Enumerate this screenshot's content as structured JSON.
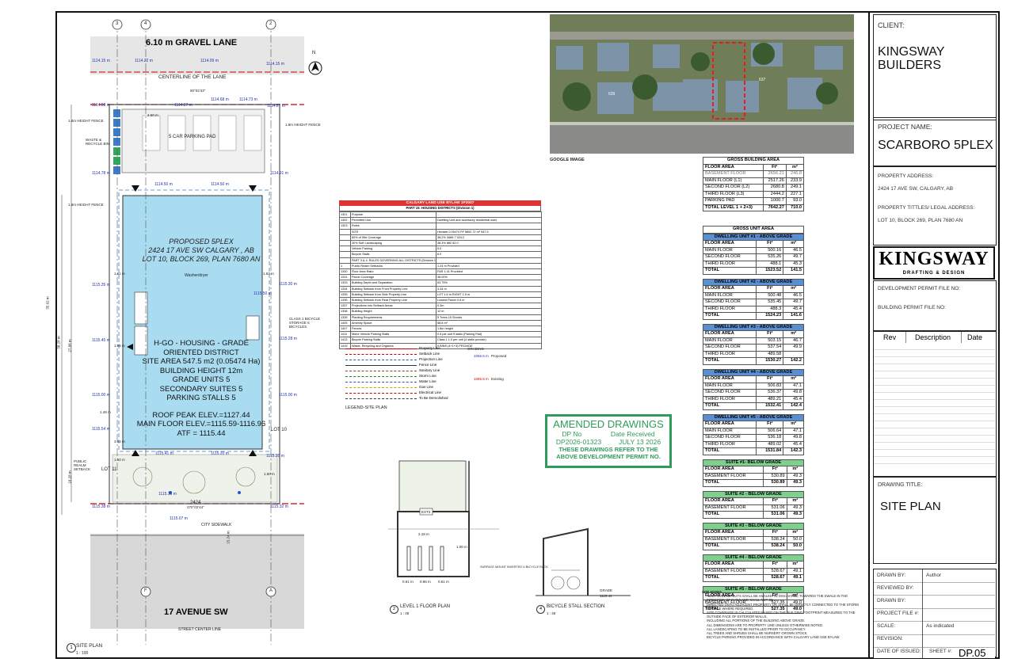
{
  "title_block": {
    "client_label": "CLIENT:",
    "client": "KINGSWAY BUILDERS",
    "project_name_label": "PROJECT NAME:",
    "project_name": "SCARBORO 5PLEX",
    "property_address_label": "PROPERTY ADDRESS:",
    "property_address": "2424 17 AVE SW, CALGARY, AB",
    "property_titles_label": "PROPERTY TITTLES/ LEGAL ADDRESS:",
    "property_titles": "LOT 10, BLOCK 269, PLAN 7680 AN",
    "logo_main": "KINGSWAY",
    "logo_sub": "DRAFTING & DESIGN",
    "dp_file_label": "DEVELOPMENT PERMIT FILE NO:",
    "bp_file_label": "BUILDING PERMIT  FILE NO:",
    "rev_headers": [
      "Rev",
      "Description",
      "Date"
    ],
    "drawing_title_label": "DRAWING TITLE:",
    "drawing_title": "SITE PLAN",
    "drawn_by_label": "DRAWN BY:",
    "drawn_by": "Author",
    "reviewed_by_label": "REVIEWED BY:",
    "drawn_by2_label": "DRAWN BY:",
    "project_file_label": "PROJECT FILE #:",
    "scale_label": "SCALE:",
    "scale": "As indicated",
    "revision_label": "REVISION:",
    "date_of_issue_label": "DATE OF ISSUED:",
    "sheet_label": "SHEET #:",
    "sheet": "DP.05"
  },
  "site_plan": {
    "lane": "6.10 m GRAVEL LANE",
    "lane_centerline": "CENTERLINE OF THE LANE",
    "avenue": "17 AVENUE SW",
    "street_centerline": "STREET CENTER LINE",
    "city_sidewalk": "CITY SIDEWALK",
    "public_realm": "PUBLIC REALM SETBACK",
    "parking_pad": "5 CAR PARKING PAD",
    "waste_bin": "WASTE & RECYCLE BIN",
    "height_fence_1": "1.8m HEIGHT FENCE",
    "height_fence_2": "1.8m HEIGHT FENCE",
    "height_fence_3": "1.8m HEIGHT FENCE",
    "bicycle_storage": "CLASS 1 BICYCLE STORAGE 6 BICYCLES",
    "north": "N",
    "proposed": "PROPOSED 5PLEX",
    "address": "2424 17 AVE SW CALGARY , AB",
    "legal": "LOT 10, BLOCK 269, PLAN 7680 AN",
    "zoning_1": "H-GO - HOUSING - GRADE",
    "zoning_2": "ORIENTED DISTRICT",
    "site_area": "SITE AREA 547.5 m2 (0.05474 Ha)",
    "building_height": "BUILDING HEIGHT 12m",
    "grade_units": "GRADE UNITS 5",
    "secondary_suites": "SECONDARY SUITES 5",
    "parking_stalls": "PARKING STALLS 5",
    "roof_peak": "ROOF PEAK ELEV.=1127.44",
    "main_floor": "MAIN FLOOR ELEV.=1115.59-1116.96",
    "atf": "ATF = 1115.44",
    "washer": "Washer/dryer",
    "number": "2424",
    "label_number": "1",
    "label_title": "SITE PLAN",
    "label_scale": "1 : 100",
    "grid_3": "3",
    "grid_4": "4",
    "grid_2": "2",
    "grid_f": "F",
    "grid_a": "A",
    "dims": {
      "d1": "1114.15 m",
      "d2": "1114.22 m",
      "d3": "1114.09 m",
      "d4": "1114.15 m",
      "d5": "1114.96 m",
      "d6": "1114.87 m",
      "d7": "1114.68 m",
      "d8": "1114.73 m",
      "d9": "1114.87 m",
      "d10": "1114.78 m",
      "d11": "1114.91 m",
      "d12": "1114.50 m",
      "d13": "1114.50 m",
      "d14": "1115.35 m",
      "d15": "1115.30 m",
      "d16": "1115.50 m",
      "d17": "1115.28 m",
      "d18": "1115.45 m",
      "d19": "1115.00 m",
      "d20": "1115.54 m",
      "d21": "1115.00 m",
      "d22": "1115.41 m",
      "d23": "1115.20 m",
      "d24": "1115.28 m",
      "d25": "1115.16 m",
      "d26": "1115.38 m",
      "d27": "1115.32 m",
      "d28": "1115.07 m",
      "bearing": "90°02'43\"",
      "bearing2": "270°02'44\"",
      "v1": "38.28 m",
      "v2": "27.88 m",
      "v3": "35.92 m",
      "v4": "35.94 m",
      "v5": "18.28 m",
      "w1": "2.50 m",
      "w2": "1.50 m",
      "w3": "1.61 m",
      "w4": "1.63 m",
      "w5": "1.65 m",
      "w6": "1.49 m",
      "w7": "3.64 m",
      "w8": "1.50 m",
      "w9": "15.24 m"
    },
    "lot_left": "LOT 11",
    "lot_right": "LOT 10"
  },
  "google": {
    "label": "GOOGLE IMAGE",
    "house_a": "639",
    "house_b": "637"
  },
  "bylaw": {
    "title": "CALGARY LAND USE BYLAW 1P2007",
    "part": "PART 15: HOUSING DISTRICTS (Division 1)",
    "rows": [
      [
        "1301",
        "Purpose",
        "..."
      ],
      [
        "1302",
        "Permitted Use",
        "Dwelling Unit and accessory residential uses"
      ],
      [
        "1303",
        "Rules",
        ""
      ],
      [
        "",
        "SITE",
        "Hectare  0.05474   Ft²  5892.72   m²  547.5"
      ],
      [
        "",
        "60% of Site Coverage",
        "38.2%   3489.7   324.2"
      ],
      [
        "",
        "30% Soft Landscaping",
        "38.3%   882   82.0"
      ],
      [
        "",
        "Vehicle Parking",
        "5.0"
      ],
      [
        "",
        "Bicycle Stalls",
        "6.0"
      ],
      [
        "",
        "PART 3 & 4: RULES GOVERNING ALL DISTRICTS (Division 1)",
        ""
      ],
      [
        "1",
        "Public Realm Setbacks",
        "1.24 m Provided"
      ],
      [
        "1330",
        "Floor Area Ratio",
        "FAR 1.41 Provided"
      ],
      [
        "1331",
        "Parcel Coverage",
        "38.00%"
      ],
      [
        "1333",
        "Building Depth and Separation",
        "63.75%"
      ],
      [
        "1334",
        "Building Setback from Front Property Line",
        "3.34 m"
      ],
      [
        "1335",
        "Building Setback from Side Property Line",
        "LOT 1.6 m   RIGHT 1.5 m"
      ],
      [
        "1336",
        "Building Setback from Rear Property Line",
        "Lowest Parcel 0.6 m"
      ],
      [
        "1337",
        "Projections into Setback Areas",
        "0.3m"
      ],
      [
        "1338",
        "Building Height",
        "12 m"
      ],
      [
        "1339",
        "Planting Requirements",
        "5 Trees   15 Shrubs"
      ],
      [
        "1405",
        "Amenity Space",
        "58.8 m²"
      ],
      [
        "1407",
        "Fences",
        "1.8m height"
      ],
      [
        "1411",
        "Motor Vehicle Parking Stalls",
        "0.5 per unit 5 stalls (Parking Pad)"
      ],
      [
        "1413",
        "Bicycle Parking Stalls",
        "Class 1 1.0 per unit (4 stalls provide)"
      ],
      [
        "1415",
        "Waste, Recycling and Organics",
        "9 BINS (4+1+3) PROVIDE"
      ]
    ]
  },
  "legend": {
    "title": "LEGEND-SITE PLAN",
    "items": [
      "Property Line",
      "Setback Line",
      "Projection Line",
      "Fence Line",
      "Sanitary Line",
      "Storm Line",
      "Water Line",
      "Gas Line",
      "Electrical Line",
      "To Be Demolished"
    ],
    "grading": "GRADING",
    "proposed": "Proposed",
    "existing": "Existing",
    "proposed_val": "1065.5 m",
    "existing_val": "1065.5 m"
  },
  "stamp": {
    "title": "AMENDED DRAWINGS",
    "dp_no_label": "DP No",
    "date_label": "Date Received",
    "dp_no": "DP2026-01323",
    "date": "JULY 13 2026",
    "note1": "THESE DRAWINGS REFER TO THE",
    "note2": "ABOVE DEVELOPMENT PERMIT NO."
  },
  "level1": {
    "number": "2",
    "title": "LEVEL 1 FLOOR PLAN",
    "scale": "1 : 48",
    "d1": "2.18 m",
    "d2": "1.00 m",
    "d3": "0.61 m",
    "d4": "0.96 m",
    "d5": "0.61 m",
    "note": "SURFACE MOUNT INVERTED U BICYCLE RACK",
    "ext": "EXT3"
  },
  "bicycle": {
    "number": "4",
    "title": "BICYCLE STALL SECTION",
    "scale": "1 : 48",
    "grade": "GRADE",
    "grade_val": "1115.44"
  },
  "gross_building": {
    "title": "GROSS BUILDING AREA",
    "headers": [
      "FLOOR AREA",
      "Ft²",
      "m²"
    ],
    "rows": [
      [
        "BASEMENT FLOOR",
        "2656.21",
        "246.8"
      ],
      [
        "MAIN FLOOR  (L1)",
        "2517.26",
        "233.9"
      ],
      [
        "SECOND FLOOR (L2)",
        "2680.8",
        "249.1"
      ],
      [
        "THIRD FLOOR (L3)",
        "2444.2",
        "227.1"
      ],
      [
        "PARKING PAD",
        "1000.7",
        "93.0"
      ],
      [
        "TOTAL LEVEL 1 + 2+3)",
        "7642.27",
        "710.0"
      ]
    ]
  },
  "gross_unit": {
    "title": "GROSS UNIT AREA",
    "headers": [
      "FLOOR AREA",
      "Ft²",
      "m²"
    ],
    "units": [
      {
        "title": "DWELLING UNIT #1 - ABOVE GRADE",
        "rows": [
          [
            "MAIN FLOOR",
            "500.16",
            "46.5"
          ],
          [
            "SECOND FLOOR",
            "535.26",
            "49.7"
          ],
          [
            "THIRD FLOOR",
            "488.1",
            "45.3"
          ],
          [
            "TOTAL",
            "1523.52",
            "141.5"
          ]
        ]
      },
      {
        "title": "DWELLING UNIT #2 - ABOVE GRADE",
        "rows": [
          [
            "MAIN FLOOR",
            "500.48",
            "46.5"
          ],
          [
            "SECOND FLOOR",
            "535.45",
            "49.7"
          ],
          [
            "THIRD FLOOR",
            "488.3",
            "45.4"
          ],
          [
            "TOTAL",
            "1524.23",
            "141.6"
          ]
        ]
      },
      {
        "title": "DWELLING UNIT #3 - ABOVE GRADE",
        "rows": [
          [
            "MAIN FLOOR",
            "503.15",
            "46.7"
          ],
          [
            "SECOND FLOOR",
            "537.54",
            "49.9"
          ],
          [
            "THIRD FLOOR",
            "489.58",
            ""
          ],
          [
            "TOTAL",
            "1530.27",
            "142.2"
          ]
        ]
      },
      {
        "title": "DWELLING UNIT #4 - ABOVE GRADE",
        "rows": [
          [
            "MAIN FLOOR",
            "506.83",
            "47.1"
          ],
          [
            "SECOND FLOOR",
            "536.37",
            "49.8"
          ],
          [
            "THIRD FLOOR",
            "489.21",
            "45.4"
          ],
          [
            "TOTAL",
            "1532.41",
            "142.4"
          ]
        ]
      },
      {
        "title": "DWELLING UNIT #5 - ABOVE GRADE",
        "rows": [
          [
            "MAIN FLOOR",
            "506.64",
            "47.1"
          ],
          [
            "SECOND FLOOR",
            "536.18",
            "49.8"
          ],
          [
            "THIRD FLOOR",
            "489.02",
            "45.4"
          ],
          [
            "TOTAL",
            "1531.84",
            "142.3"
          ]
        ]
      }
    ],
    "suites": [
      {
        "title": "SUITE #1- BELOW GRADE",
        "rows": [
          [
            "BASEMENT FLOOR",
            "530.89",
            "49.3"
          ],
          [
            "TOTAL",
            "530.89",
            "49.3"
          ]
        ]
      },
      {
        "title": "SUITE #2 - BELOW GRADE",
        "rows": [
          [
            "BASEMENT FLOOR",
            "531.06",
            "49.3"
          ],
          [
            "TOTAL",
            "531.06",
            "49.3"
          ]
        ]
      },
      {
        "title": "SUITE #3 - BELOW GRADE",
        "rows": [
          [
            "BASEMENT FLOOR",
            "538.24",
            "50.0"
          ],
          [
            "TOTAL",
            "538.24",
            "50.0"
          ]
        ]
      },
      {
        "title": "SUITE #4 - BELOW GRADE",
        "rows": [
          [
            "BASEMENT FLOOR",
            "528.67",
            "49.1"
          ],
          [
            "TOTAL",
            "528.67",
            "49.1"
          ]
        ]
      },
      {
        "title": "SUITE #5 - BELOW GRADE",
        "rows": [
          [
            "BASEMENT FLOOR",
            "527.35",
            "49.0"
          ],
          [
            "TOTAL",
            "527.35",
            "49.0"
          ]
        ]
      }
    ]
  },
  "site_notes": {
    "title": "SITE NOTES",
    "items": [
      "ROOF DOWNSPOUTS SHALL BE ANGLED TO DISCHARGE TOWARDS THE SWALE IN THE DIRECTION OF FLOW AND SHALL NOT BE",
      "DIRECTED ONTO ADJACENT PROPERTY OR SHALL BE DIRECTLY CONNECTED TO THE STORM SERVICE WHERE REQUIRED.",
      "SITE COVERAGE IS CALCULATED BASED ON THE BUILDING FOOTPRINT MEASURED TO THE OUTSIDE FACE OF EXTERIOR WALLS,",
      "INCLUDING ALL PORTIONS OF THE BUILDING ABOVE GRADE.",
      "ALL DIMENSIONS ARE TO PROPERTY LINE UNLESS OTHERWISE NOTED.",
      "ALL LANDSCAPING TO BE INSTALLED PRIOR TO OCCUPANCY.",
      "ALL TREES AND SHRUBS SHALL BE NURSERY GROWN STOCK.",
      "BICYCLE PARKING PROVIDED IN ACCORDANCE WITH CALGARY LAND USE BYLAW."
    ]
  }
}
